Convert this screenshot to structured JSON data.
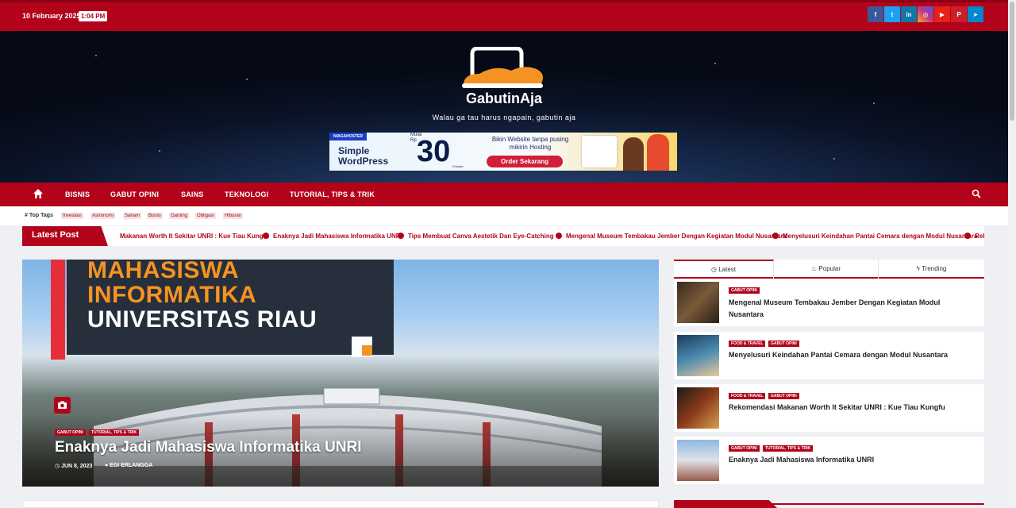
{
  "topbar": {
    "date": "10 February 2025",
    "time": "1:04 PM",
    "socials": [
      {
        "name": "facebook",
        "glyph": "f",
        "color": "#3b5998"
      },
      {
        "name": "twitter",
        "glyph": "t",
        "color": "#1da1f2"
      },
      {
        "name": "linkedin",
        "glyph": "in",
        "color": "#0e76a8"
      },
      {
        "name": "instagram",
        "glyph": "◎",
        "color": "#c13584"
      },
      {
        "name": "youtube",
        "glyph": "▶",
        "color": "#e62117"
      },
      {
        "name": "pinterest",
        "glyph": "P",
        "color": "#cb2027"
      },
      {
        "name": "telegram",
        "glyph": "➤",
        "color": "#0088cc"
      }
    ]
  },
  "header": {
    "site_name": "GabutinAja",
    "tagline": "Walau ga tau harus ngapain, gabutin aja"
  },
  "ad": {
    "brand": "NIAGAHOSTER",
    "headline": "Simple WordPress",
    "mulai": "Mulai Rp",
    "price": "30",
    "per": "K/bulan",
    "copy": "Bikin Website tanpa pusing mikirin Hosting",
    "button": "Order Sekarang"
  },
  "nav": {
    "items": [
      "BISNIS",
      "GABUT OPINI",
      "SAINS",
      "TEKNOLOGI",
      "TUTORIAL, TIPS & TRIK"
    ]
  },
  "tags": {
    "label": "Top Tags",
    "items": [
      "Investasi",
      "Astronomi",
      "Saham",
      "Bisnis",
      "Gaming",
      "Obligasi",
      "Hiburan"
    ]
  },
  "latest": {
    "label": "Latest Post",
    "items": [
      "Makanan Worth It Sekitar UNRI : Kue Tiau Kungfu",
      "Enaknya Jadi Mahasiswa Informatika UNRI",
      "Tips Membuat Canva Aestetik Dan Eye-Catching",
      "Mengenal Museum Tembakau Jember Dengan Kegiatan Modul Nusantara",
      "Menyelusuri Keindahan Pantai Cemara dengan Modul Nusantara",
      "Rek"
    ]
  },
  "feature": {
    "overlay": [
      "MAHASISWA",
      "INFORMATIKA",
      "UNIVERSITAS RIAU"
    ],
    "categories": [
      "GABUT OPINI",
      "TUTORIAL, TIPS & TRIK"
    ],
    "title": "Enaknya Jadi Mahasiswa Informatika UNRI",
    "date": "JUN 8, 2023",
    "author": "EGI ERLANGGA"
  },
  "sidebar": {
    "tabs": [
      "Latest",
      "Popular",
      "Trending"
    ],
    "posts": [
      {
        "categories": [
          "GABUT OPINI"
        ],
        "title": "Mengenal Museum Tembakau Jember Dengan Kegiatan Modul Nusantara"
      },
      {
        "categories": [
          "FOOD & TRAVEL",
          "GABUT OPINI"
        ],
        "title": "Menyelusuri Keindahan Pantai Cemara dengan Modul Nusantara"
      },
      {
        "categories": [
          "FOOD & TRAVEL",
          "GABUT OPINI"
        ],
        "title": "Rekomendasi Makanan Worth It Sekitar UNRI : Kue Tiau Kungfu"
      },
      {
        "categories": [
          "GABUT OPINI",
          "TUTORIAL, TIPS & TRIK"
        ],
        "title": "Enaknya Jadi Mahasiswa Informatika UNRI"
      }
    ]
  },
  "colors": {
    "brand": "#b2031b",
    "accent": "#f59322"
  }
}
